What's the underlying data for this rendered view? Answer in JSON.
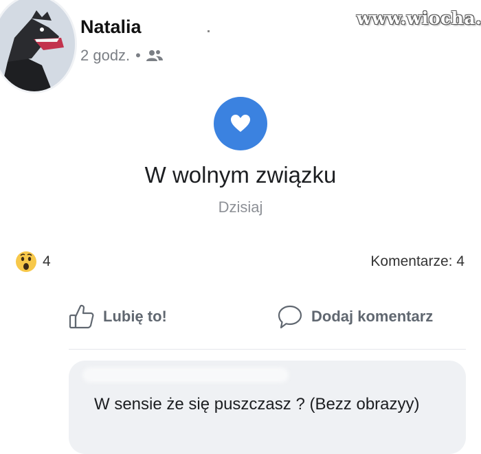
{
  "watermark": "www.wiocha.pl",
  "post": {
    "author": "Natalia",
    "time": "2 godz.",
    "separator": "•",
    "privacy_icon": "friends-icon"
  },
  "life_event": {
    "icon": "heart-icon",
    "accent_color": "#3b82e0",
    "title": "W wolnym związku",
    "date": "Dzisiaj"
  },
  "stats": {
    "reaction_icon": "wow-emoji",
    "reaction_count": "4",
    "comments_text": "Komentarze: 4"
  },
  "actions": {
    "like_label": "Lubię to!",
    "comment_label": "Dodaj komentarz"
  },
  "comment": {
    "text": "W sensie że się puszczasz ? (Bezz obrazyy)"
  }
}
